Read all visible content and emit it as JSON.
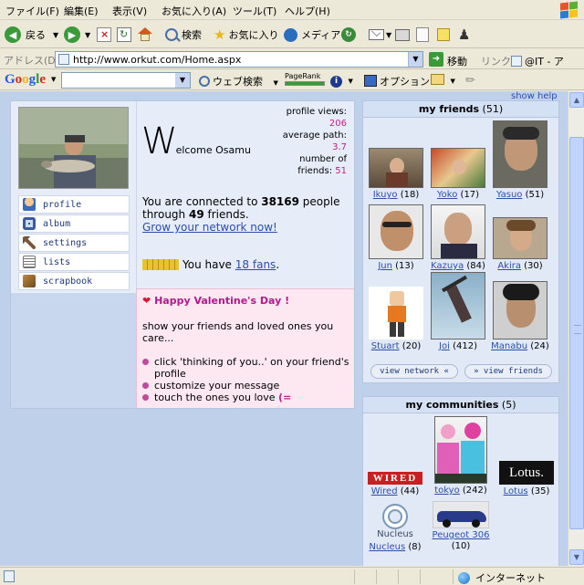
{
  "menu": [
    "ファイル(F)",
    "編集(E)",
    "表示(V)",
    "お気に入り(A)",
    "ツール(T)",
    "ヘルプ(H)"
  ],
  "toolbar": {
    "back": "戻る",
    "search": "検索",
    "favorites": "お気に入り",
    "media": "メディア"
  },
  "address": {
    "label": "アドレス(D)",
    "url": "http://www.orkut.com/Home.aspx",
    "go": "移動",
    "links": "リンク",
    "link1": "@IT - ア"
  },
  "googlebar": {
    "logo": "Google",
    "web_search": "ウェブ検索",
    "pagerank": "PageRank",
    "options": "オプション"
  },
  "page": {
    "show_help": "show help",
    "welcome_w": "W",
    "welcome_rest": "elcome Osamu",
    "stats": {
      "profile_views_label": "profile views:",
      "profile_views": "206",
      "average_path_label": "average path:",
      "average_path": "3.7",
      "num_friends_label1": "number of",
      "num_friends_label2": "friends:",
      "num_friends": "51"
    },
    "nav": [
      "profile",
      "album",
      "settings",
      "lists",
      "scrapbook"
    ],
    "connected_pre": "You are connected to ",
    "connected_count": "38169",
    "connected_mid": " people through ",
    "connected_friends": "49",
    "connected_post": " friends.",
    "grow_link": "Grow your network now!",
    "fans_pre": "You have ",
    "fans_link": "18 fans",
    "fans_post": ".",
    "valentine": {
      "title": "Happy Valentine's Day !",
      "text": "show your friends and loved ones you care...",
      "b1": "click 'thinking of you..' on your friend's profile",
      "b2": "customize your message",
      "b3_pre": "touch the ones you love ",
      "b3_smile": "(="
    }
  },
  "friends": {
    "title": "my friends",
    "count": "(51)",
    "list": [
      {
        "name": "Ikuyo",
        "count": "(18)"
      },
      {
        "name": "Yoko",
        "count": "(17)"
      },
      {
        "name": "Yasuo",
        "count": "(51)"
      },
      {
        "name": "Jun",
        "count": "(13)"
      },
      {
        "name": "Kazuya",
        "count": "(84)"
      },
      {
        "name": "Akira",
        "count": "(30)"
      },
      {
        "name": "Stuart",
        "count": "(20)"
      },
      {
        "name": "Joi",
        "count": "(412)"
      },
      {
        "name": "Manabu",
        "count": "(24)"
      }
    ],
    "view_network": "view network",
    "view_friends": "view friends"
  },
  "communities": {
    "title": "my communities",
    "count": "(5)",
    "list": [
      {
        "name": "Wired",
        "count": "(44)"
      },
      {
        "name": "tokyo",
        "count": "(242)"
      },
      {
        "name": "Lotus",
        "count": "(35)"
      },
      {
        "name": "Nucleus",
        "count": "(8)"
      },
      {
        "name": "Peugeot 306",
        "count": "(10)"
      }
    ],
    "wired_logo": "WIRED",
    "lotus_logo": "Lotus.",
    "nucleus_logo": "Nucleus"
  },
  "status": {
    "zone": "インターネット"
  }
}
